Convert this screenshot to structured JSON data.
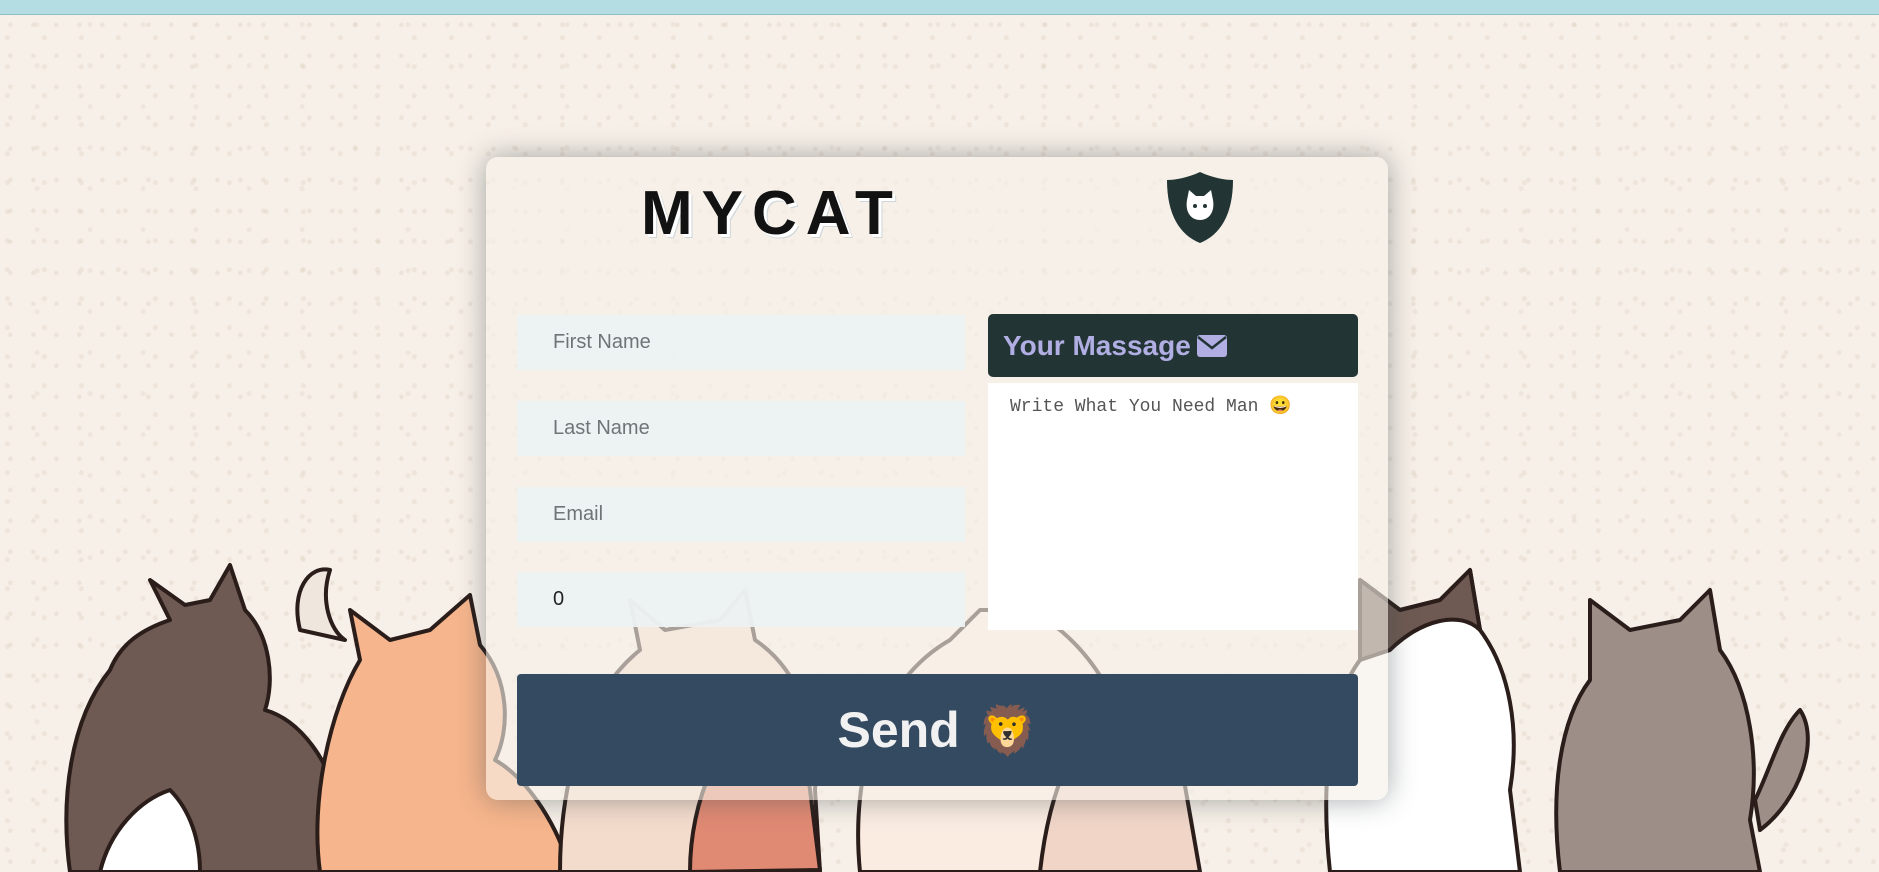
{
  "brand": {
    "title": "MYCAT"
  },
  "form": {
    "first_name": {
      "placeholder": "First Name",
      "value": ""
    },
    "last_name": {
      "placeholder": "Last Name",
      "value": ""
    },
    "email": {
      "placeholder": "Email",
      "value": ""
    },
    "number": {
      "value": "0"
    },
    "message": {
      "header": "Your Massage",
      "header_icon": "envelope-icon",
      "placeholder": "Write What You Need Man 😀"
    },
    "send": {
      "label": "Send",
      "emoji": "🦁"
    }
  },
  "colors": {
    "top_bar": "#b3dde2",
    "message_header_bg": "#223434",
    "message_header_text": "#b1aee3",
    "send_button_bg": "#344a60",
    "logo": "#223434"
  },
  "icons": {
    "logo": "cat-shield-icon"
  }
}
